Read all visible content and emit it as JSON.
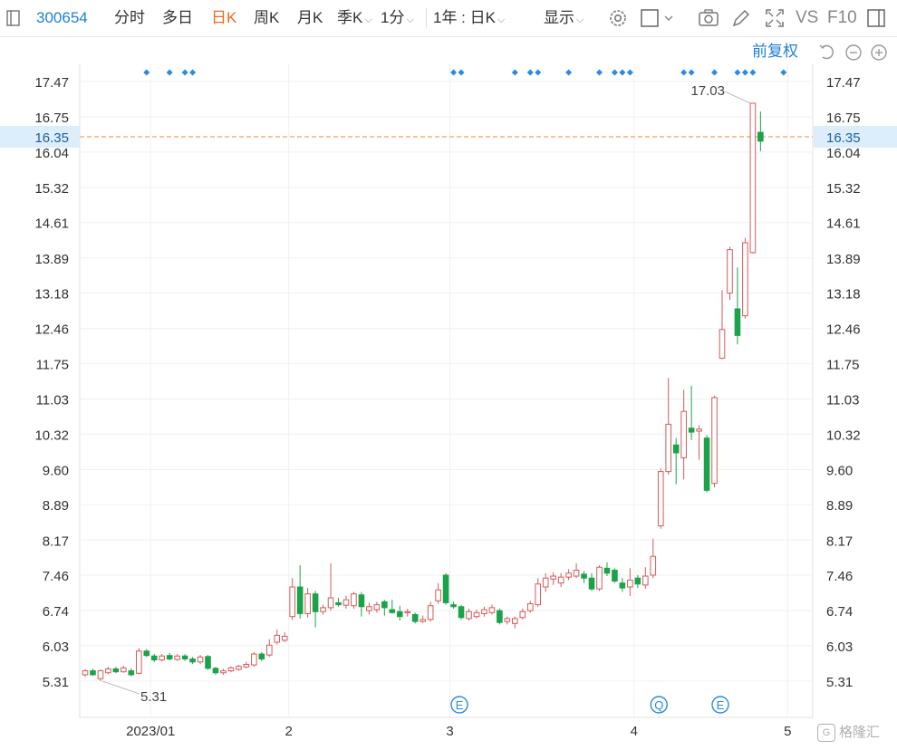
{
  "toolbar": {
    "code": "300654",
    "tabs": [
      "分时",
      "多日",
      "日K",
      "周K",
      "月K",
      "季K"
    ],
    "active_tab": "日K",
    "minute": "1分",
    "range": "1年 : 日K",
    "display": "显示",
    "vs": "VS",
    "f10": "F10"
  },
  "sub": {
    "fuquan": "前复权"
  },
  "watermark": "格隆汇",
  "chart_data": {
    "type": "candlestick",
    "yticks": [
      17.47,
      16.75,
      16.04,
      15.32,
      14.61,
      13.89,
      13.18,
      12.46,
      11.75,
      11.03,
      10.32,
      9.6,
      8.89,
      8.17,
      7.46,
      6.74,
      6.03,
      5.31
    ],
    "ylim": [
      4.95,
      17.85
    ],
    "xticks": [
      {
        "label": "2023/01",
        "i": 9
      },
      {
        "label": "2",
        "i": 27
      },
      {
        "label": "3",
        "i": 48
      },
      {
        "label": "4",
        "i": 72
      },
      {
        "label": "5",
        "i": 92
      }
    ],
    "current_price": 16.35,
    "annotations": {
      "max_label": "17.03",
      "min_label": "5.31"
    },
    "event_markers": [
      {
        "label": "E",
        "i": 49
      },
      {
        "label": "Q",
        "i": 75
      },
      {
        "label": "E",
        "i": 83
      }
    ],
    "dot_markers_idx": [
      8,
      11,
      13,
      14,
      48,
      49,
      56,
      58,
      59,
      63,
      67,
      69,
      70,
      71,
      78,
      79,
      82,
      85,
      86,
      87,
      91
    ],
    "candles": [
      [
        5.44,
        5.52,
        5.55,
        5.4
      ],
      [
        5.52,
        5.44,
        5.56,
        5.42
      ],
      [
        5.36,
        5.52,
        5.55,
        5.31
      ],
      [
        5.48,
        5.56,
        5.6,
        5.45
      ],
      [
        5.56,
        5.5,
        5.6,
        5.47
      ],
      [
        5.5,
        5.58,
        5.62,
        5.48
      ],
      [
        5.52,
        5.44,
        5.57,
        5.41
      ],
      [
        5.47,
        5.92,
        5.98,
        5.45
      ],
      [
        5.92,
        5.83,
        5.96,
        5.8
      ],
      [
        5.82,
        5.74,
        5.86,
        5.7
      ],
      [
        5.74,
        5.82,
        5.86,
        5.71
      ],
      [
        5.83,
        5.76,
        5.88,
        5.73
      ],
      [
        5.75,
        5.82,
        5.86,
        5.72
      ],
      [
        5.82,
        5.76,
        5.86,
        5.72
      ],
      [
        5.76,
        5.7,
        5.8,
        5.66
      ],
      [
        5.7,
        5.8,
        5.84,
        5.66
      ],
      [
        5.81,
        5.57,
        5.84,
        5.54
      ],
      [
        5.57,
        5.48,
        5.6,
        5.44
      ],
      [
        5.48,
        5.52,
        5.56,
        5.44
      ],
      [
        5.52,
        5.58,
        5.61,
        5.49
      ],
      [
        5.55,
        5.61,
        5.64,
        5.52
      ],
      [
        5.6,
        5.65,
        5.7,
        5.57
      ],
      [
        5.64,
        5.86,
        5.9,
        5.6
      ],
      [
        5.86,
        5.76,
        5.9,
        5.72
      ],
      [
        5.84,
        6.04,
        6.16,
        5.8
      ],
      [
        6.1,
        6.24,
        6.36,
        6.05
      ],
      [
        6.14,
        6.22,
        6.3,
        6.1
      ],
      [
        6.62,
        7.22,
        7.4,
        6.55
      ],
      [
        7.22,
        6.68,
        7.66,
        6.58
      ],
      [
        6.68,
        7.08,
        7.2,
        6.6
      ],
      [
        7.08,
        6.72,
        7.14,
        6.4
      ],
      [
        6.72,
        6.8,
        6.86,
        6.66
      ],
      [
        6.8,
        7.0,
        7.7,
        6.74
      ],
      [
        6.9,
        6.86,
        7.0,
        6.82
      ],
      [
        6.85,
        6.96,
        7.04,
        6.78
      ],
      [
        6.84,
        7.08,
        7.12,
        6.78
      ],
      [
        7.06,
        6.82,
        7.12,
        6.62
      ],
      [
        6.74,
        6.82,
        6.9,
        6.66
      ],
      [
        6.76,
        6.86,
        6.92,
        6.7
      ],
      [
        6.92,
        6.8,
        6.96,
        6.64
      ],
      [
        6.76,
        6.7,
        6.96,
        6.68
      ],
      [
        6.72,
        6.62,
        6.84,
        6.54
      ],
      [
        6.7,
        6.72,
        6.78,
        6.62
      ],
      [
        6.66,
        6.52,
        6.7,
        6.48
      ],
      [
        6.52,
        6.56,
        6.64,
        6.49
      ],
      [
        6.56,
        6.84,
        6.92,
        6.52
      ],
      [
        6.94,
        7.16,
        7.3,
        6.88
      ],
      [
        7.46,
        6.9,
        7.5,
        6.86
      ],
      [
        6.86,
        6.82,
        6.92,
        6.78
      ],
      [
        6.82,
        6.6,
        6.86,
        6.56
      ],
      [
        6.58,
        6.72,
        6.78,
        6.54
      ],
      [
        6.62,
        6.7,
        6.76,
        6.58
      ],
      [
        6.68,
        6.76,
        6.82,
        6.62
      ],
      [
        6.7,
        6.8,
        6.86,
        6.66
      ],
      [
        6.74,
        6.5,
        6.78,
        6.46
      ],
      [
        6.52,
        6.58,
        6.62,
        6.46
      ],
      [
        6.48,
        6.58,
        6.62,
        6.38
      ],
      [
        6.6,
        6.72,
        6.78,
        6.56
      ],
      [
        6.74,
        6.88,
        6.94,
        6.7
      ],
      [
        6.86,
        7.28,
        7.4,
        6.82
      ],
      [
        7.22,
        7.4,
        7.5,
        7.12
      ],
      [
        7.38,
        7.44,
        7.52,
        7.26
      ],
      [
        7.3,
        7.42,
        7.5,
        7.22
      ],
      [
        7.42,
        7.5,
        7.58,
        7.36
      ],
      [
        7.44,
        7.56,
        7.7,
        7.4
      ],
      [
        7.48,
        7.4,
        7.54,
        7.3
      ],
      [
        7.4,
        7.18,
        7.5,
        7.14
      ],
      [
        7.18,
        7.62,
        7.66,
        7.14
      ],
      [
        7.6,
        7.5,
        7.72,
        7.44
      ],
      [
        7.56,
        7.34,
        7.6,
        7.3
      ],
      [
        7.3,
        7.2,
        7.4,
        7.12
      ],
      [
        7.22,
        7.36,
        7.6,
        7.04
      ],
      [
        7.4,
        7.28,
        7.46,
        7.2
      ],
      [
        7.26,
        7.44,
        7.62,
        7.18
      ],
      [
        7.46,
        7.84,
        8.2,
        7.4
      ],
      [
        8.46,
        9.56,
        9.62,
        8.4
      ],
      [
        9.56,
        10.52,
        11.46,
        9.5
      ],
      [
        10.1,
        9.94,
        10.24,
        9.3
      ],
      [
        9.84,
        10.78,
        11.22,
        9.4
      ],
      [
        10.44,
        10.36,
        11.3,
        10.2
      ],
      [
        10.38,
        10.42,
        10.5,
        9.8
      ],
      [
        10.24,
        9.18,
        10.3,
        9.14
      ],
      [
        9.32,
        11.06,
        11.1,
        9.24
      ],
      [
        11.86,
        12.44,
        13.24,
        11.84
      ],
      [
        13.18,
        14.06,
        14.12,
        13.04
      ],
      [
        12.86,
        12.32,
        13.7,
        12.14
      ],
      [
        12.72,
        14.2,
        14.3,
        12.66
      ],
      [
        14.0,
        17.03,
        17.03,
        13.98
      ],
      [
        16.44,
        16.26,
        16.86,
        16.06
      ]
    ]
  }
}
